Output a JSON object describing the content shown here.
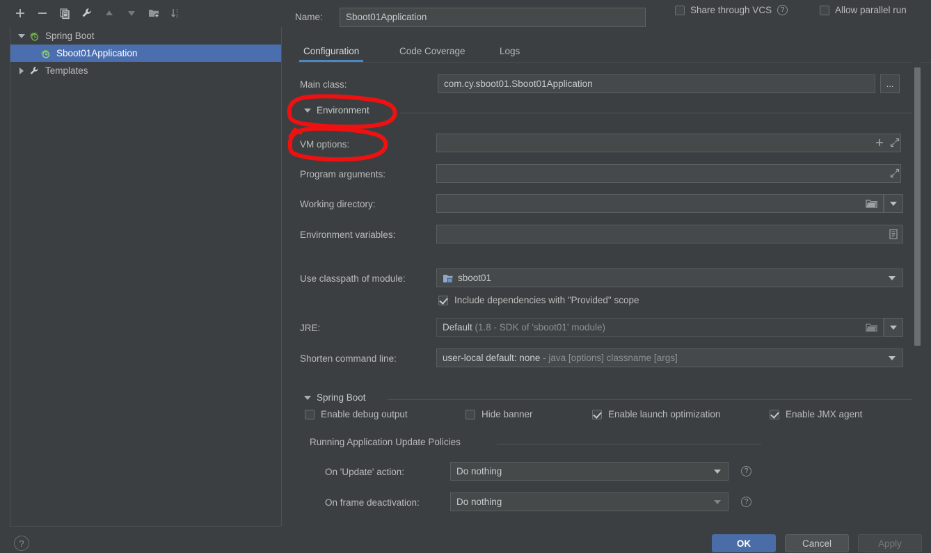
{
  "dialog": {
    "accent_color": "#4a88c7",
    "selection_color": "#4b6eaf",
    "annotation_color": "#ee1111",
    "background": "#3c3f41"
  },
  "sidebar": {
    "toolbar": [
      {
        "name": "add",
        "glyph": "+"
      },
      {
        "name": "remove",
        "glyph": "-"
      },
      {
        "name": "copy",
        "glyph": "copy-icon"
      },
      {
        "name": "edit-templates",
        "glyph": "wrench-icon"
      },
      {
        "name": "move-up",
        "glyph": "arrow-up-icon"
      },
      {
        "name": "move-down",
        "glyph": "arrow-down-icon"
      },
      {
        "name": "new-folder",
        "glyph": "folder-add-icon"
      },
      {
        "name": "sort",
        "glyph": "sort-az-icon"
      }
    ],
    "tree": [
      {
        "label": "Spring Boot",
        "level": 1,
        "expanded": true,
        "selected": false,
        "icon": "spring-boot-icon"
      },
      {
        "label": "Sboot01Application",
        "level": 2,
        "expanded": null,
        "selected": true,
        "icon": "spring-boot-icon"
      },
      {
        "label": "Templates",
        "level": 1,
        "expanded": false,
        "selected": false,
        "icon": "wrench-icon"
      }
    ],
    "help_label": "?"
  },
  "header": {
    "name_label": "Name:",
    "name_value": "Sboot01Application",
    "name_placeholder": "",
    "share_vcs_label": "Share through VCS",
    "share_vcs_checked": false,
    "share_vcs_help": "?",
    "allow_parallel_label": "Allow parallel run",
    "allow_parallel_checked": false
  },
  "tabs": [
    {
      "label": "Configuration",
      "active": true
    },
    {
      "label": "Code Coverage",
      "active": false
    },
    {
      "label": "Logs",
      "active": false
    }
  ],
  "form": {
    "main_class_label": "Main class:",
    "main_class_value": "com.cy.sboot01.Sboot01Application",
    "main_class_browse": "...",
    "environment_section": "Environment",
    "vm_options_label": "VM options:",
    "vm_options_value": "",
    "vm_options_add_icon": "plus-icon",
    "vm_options_expand_icon": "expand-icon",
    "program_arguments_label": "Program arguments:",
    "program_arguments_value": "",
    "program_arguments_expand_icon": "expand-icon",
    "working_directory_label": "Working directory:",
    "working_directory_value": "",
    "working_directory_browse_icon": "folder-icon",
    "environment_variables_label": "Environment variables:",
    "environment_variables_value": "",
    "environment_variables_browse_icon": "list-icon",
    "use_classpath_label": "Use classpath of module:",
    "use_classpath_value": "sboot01",
    "use_classpath_icon": "module-icon",
    "include_provided_label": "Include dependencies with \"Provided\" scope",
    "include_provided_checked": true,
    "jre_label": "JRE:",
    "jre_value": "Default",
    "jre_value_hint": "(1.8 - SDK of 'sboot01' module)",
    "jre_browse_icon": "folder-icon",
    "shorten_label": "Shorten command line:",
    "shorten_value": "user-local default: none",
    "shorten_value_hint": "- java [options] classname [args]"
  },
  "spring_boot": {
    "section_label": "Spring Boot",
    "checkboxes": [
      {
        "label": "Enable debug output",
        "checked": false
      },
      {
        "label": "Hide banner",
        "checked": false
      },
      {
        "label": "Enable launch optimization",
        "checked": true
      },
      {
        "label": "Enable JMX agent",
        "checked": true
      }
    ],
    "policies_label": "Running Application Update Policies",
    "policies": [
      {
        "label": "On 'Update' action:",
        "value": "Do nothing",
        "help": "?",
        "enabled": true
      },
      {
        "label": "On frame deactivation:",
        "value": "Do nothing",
        "help": "?",
        "enabled": false
      }
    ]
  },
  "buttons": {
    "ok": "OK",
    "cancel": "Cancel",
    "apply": "Apply"
  },
  "annotations": [
    {
      "name": "environment-highlight",
      "target": "Environment"
    },
    {
      "name": "vm-options-highlight",
      "target": "VM options:"
    }
  ]
}
